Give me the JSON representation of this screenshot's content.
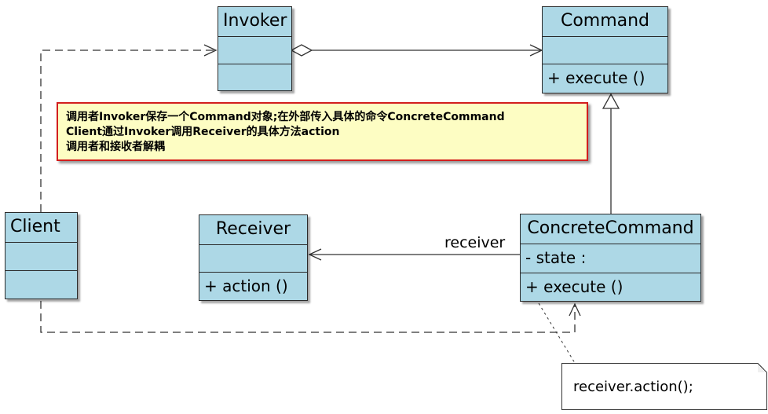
{
  "classes": {
    "invoker": {
      "name": "Invoker",
      "attributes": [],
      "operations": []
    },
    "command": {
      "name": "Command",
      "attributes": [],
      "operations": [
        "+ execute ()"
      ]
    },
    "client": {
      "name": "Client",
      "attributes": [],
      "operations": []
    },
    "receiver": {
      "name": "Receiver",
      "attributes": [],
      "operations": [
        "+ action ()"
      ]
    },
    "concrete_command": {
      "name": "ConcreteCommand",
      "attributes": [
        "- state :"
      ],
      "operations": [
        "+ execute ()"
      ]
    }
  },
  "relations": {
    "receiver_role": "receiver"
  },
  "notes": {
    "description_lines": [
      "调用者Invoker保存一个Command对象;在外部传入具体的命令ConcreteCommand",
      "Client通过Invoker调用Receiver的具体方法action",
      "调用者和接收者解耦"
    ],
    "code": "receiver.action();"
  },
  "colors": {
    "class_fill": "#add8e6",
    "note_fill": "#fdfdc3",
    "note_border": "#d21e1e"
  }
}
